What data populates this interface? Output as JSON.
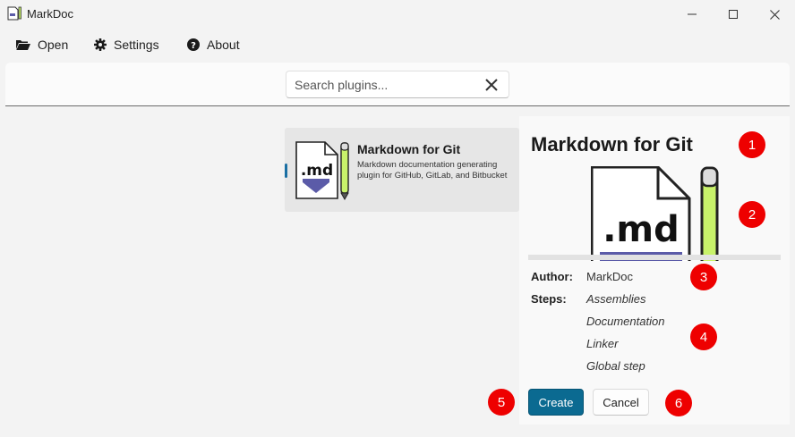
{
  "window": {
    "title": "MarkDoc"
  },
  "menu": [
    {
      "label": "Open",
      "icon": "folder-open-icon"
    },
    {
      "label": "Settings",
      "icon": "gear-icon"
    },
    {
      "label": "About",
      "icon": "help-circle-icon"
    }
  ],
  "search": {
    "placeholder": "Search plugins...",
    "value": ""
  },
  "plugins": [
    {
      "name": "Markdown for Git",
      "description": "Markdown documentation generating plugin for GitHub, GitLab, and Bitbucket",
      "icon_text": ".md",
      "selected": true
    }
  ],
  "details": {
    "title": "Markdown for Git",
    "image_text": ".md",
    "author_label": "Author:",
    "author": "MarkDoc",
    "steps_label": "Steps:",
    "steps": [
      "Assemblies",
      "Documentation",
      "Linker",
      "Global step"
    ],
    "create_label": "Create",
    "cancel_label": "Cancel"
  },
  "markers": [
    "1",
    "2",
    "3",
    "4",
    "5",
    "6"
  ],
  "colors": {
    "accent": "#0b6a91",
    "marker": "#ee0000",
    "selection": "#1a6fa3",
    "pencil": "#c8f26a"
  }
}
